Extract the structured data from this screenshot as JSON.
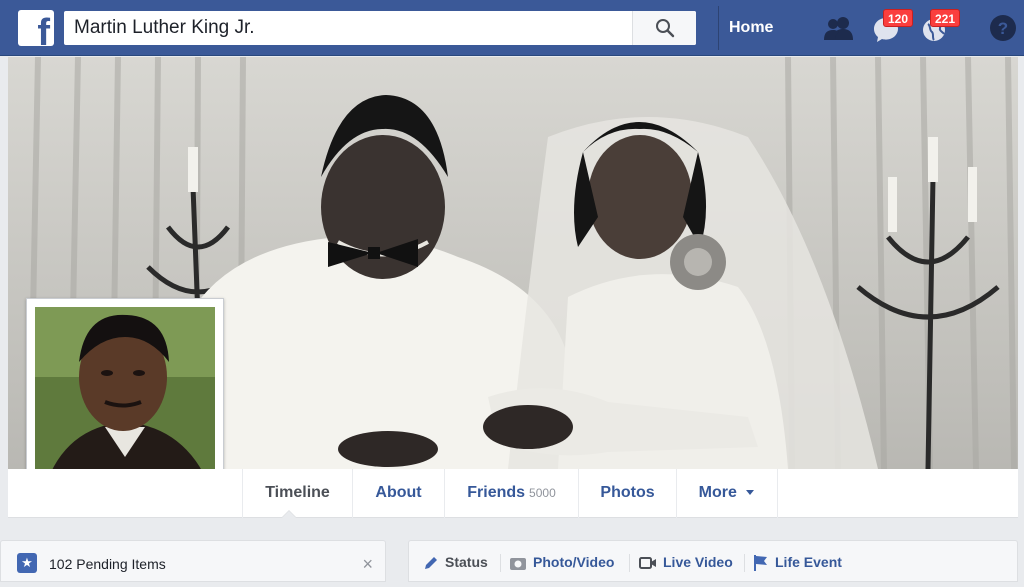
{
  "search": {
    "value": "Martin Luther King Jr."
  },
  "nav": {
    "home_label": "Home",
    "messages_badge": "120",
    "notifications_badge": "221"
  },
  "tabs": [
    {
      "label": "Timeline"
    },
    {
      "label": "About"
    },
    {
      "label": "Friends",
      "count": "5000"
    },
    {
      "label": "Photos"
    },
    {
      "label": "More"
    }
  ],
  "pending": {
    "label": "102 Pending Items",
    "close": "×"
  },
  "composer": {
    "items": [
      {
        "label": "Status"
      },
      {
        "label": "Photo/Video"
      },
      {
        "label": "Live Video"
      },
      {
        "label": "Life Event"
      }
    ]
  },
  "icons": {
    "logo": "facebook-logo-icon",
    "search": "search-icon",
    "friends": "friend-requests-icon",
    "messages": "messages-icon",
    "notifications": "notifications-globe-icon",
    "help": "help-icon"
  },
  "colors": {
    "brand_blue": "#3b5998",
    "link_blue": "#365899",
    "badge_red": "#fa3e3e",
    "page_bg": "#e9ebee"
  }
}
